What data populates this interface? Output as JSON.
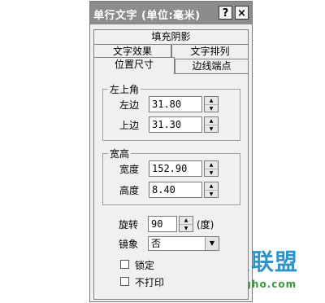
{
  "window": {
    "title": "单行文字 (单位:毫米)",
    "help_btn": "?",
    "close_btn": "×"
  },
  "tabs": {
    "row1": [
      "填充阴影"
    ],
    "row2": [
      "文字效果",
      "文字排列"
    ],
    "row3": [
      "位置尺寸",
      "边线端点"
    ],
    "active": "位置尺寸"
  },
  "top_left": {
    "label": "左上角",
    "left_label": "左边",
    "left_value": "31.80",
    "top_label": "上边",
    "top_value": "31.30"
  },
  "size": {
    "label": "宽高",
    "width_label": "宽度",
    "width_value": "152.90",
    "height_label": "高度",
    "height_value": "8.40"
  },
  "rotate": {
    "label": "旋转",
    "value": "90",
    "unit": "(度)"
  },
  "mirror": {
    "label": "镜象",
    "value": "否"
  },
  "checkboxes": {
    "lock_label": "锁定",
    "noprint_label": "不打印"
  },
  "watermark": {
    "brand": "技术员联盟",
    "url": "www.jsgho.com"
  }
}
